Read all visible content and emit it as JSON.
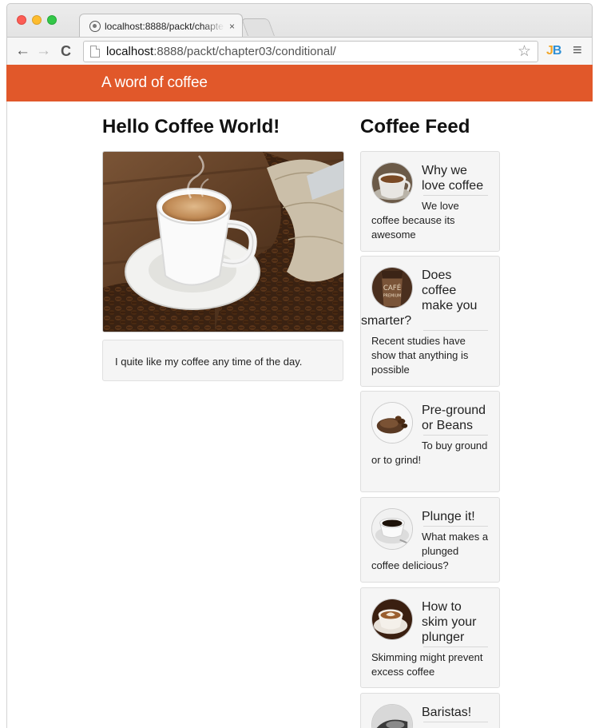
{
  "browser": {
    "tab_title": "localhost:8888/packt/chapter03/conditional/",
    "tab_close": "×",
    "url_host": "localhost",
    "url_rest": ":8888/packt/chapter03/conditional/",
    "extension_label_j": "J",
    "extension_label_b": "B"
  },
  "navbar": {
    "brand": "A word of coffee",
    "color": "#e1582a"
  },
  "main": {
    "heading": "Hello Coffee World!",
    "image_subject": "coffee cup with beans",
    "card_text": "I quite like my coffee any time of the day."
  },
  "feed": {
    "heading": "Coffee Feed",
    "items": [
      {
        "title": "Why we love coffee",
        "description": "We love coffee because its awesome",
        "thumb": "coffee-cup-thumbnail"
      },
      {
        "title": "Does coffee make you smarter?",
        "description": "Recent studies have show that anything is possible",
        "thumb": "cafe-premium-cup-thumbnail"
      },
      {
        "title": "Pre-ground or Beans",
        "description": "To buy ground or to grind!",
        "thumb": "ground-coffee-thumbnail"
      },
      {
        "title": "Plunge it!",
        "description": "What makes a plunged coffee delicious?",
        "thumb": "espresso-cup-thumbnail"
      },
      {
        "title": "How to skim your plunger",
        "description": "Skimming might prevent excess coffee",
        "thumb": "latte-thumbnail"
      },
      {
        "title": "Baristas!",
        "description": "",
        "thumb": "barista-thumbnail"
      }
    ]
  }
}
